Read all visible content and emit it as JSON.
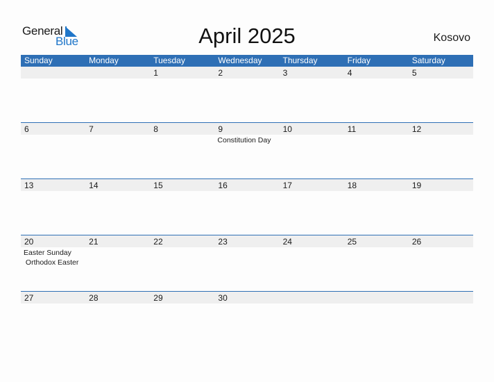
{
  "logo": {
    "part1": "General",
    "part2": "Blue"
  },
  "title": "April 2025",
  "country": "Kosovo",
  "weekdays": [
    "Sunday",
    "Monday",
    "Tuesday",
    "Wednesday",
    "Thursday",
    "Friday",
    "Saturday"
  ],
  "weeks": [
    [
      {
        "day": ""
      },
      {
        "day": ""
      },
      {
        "day": "1"
      },
      {
        "day": "2"
      },
      {
        "day": "3"
      },
      {
        "day": "4"
      },
      {
        "day": "5"
      }
    ],
    [
      {
        "day": "6"
      },
      {
        "day": "7"
      },
      {
        "day": "8"
      },
      {
        "day": "9",
        "holidays": [
          "Constitution Day"
        ]
      },
      {
        "day": "10"
      },
      {
        "day": "11"
      },
      {
        "day": "12"
      }
    ],
    [
      {
        "day": "13"
      },
      {
        "day": "14"
      },
      {
        "day": "15"
      },
      {
        "day": "16"
      },
      {
        "day": "17"
      },
      {
        "day": "18"
      },
      {
        "day": "19"
      }
    ],
    [
      {
        "day": "20",
        "holidays": [
          "Easter Sunday",
          " Orthodox Easter"
        ]
      },
      {
        "day": "21"
      },
      {
        "day": "22"
      },
      {
        "day": "23"
      },
      {
        "day": "24"
      },
      {
        "day": "25"
      },
      {
        "day": "26"
      }
    ],
    [
      {
        "day": "27"
      },
      {
        "day": "28"
      },
      {
        "day": "29"
      },
      {
        "day": "30"
      },
      {
        "day": ""
      },
      {
        "day": ""
      },
      {
        "day": ""
      }
    ]
  ],
  "colors": {
    "accent": "#2e6fb5",
    "band": "#efefef",
    "logo_blue": "#1f76c9"
  }
}
